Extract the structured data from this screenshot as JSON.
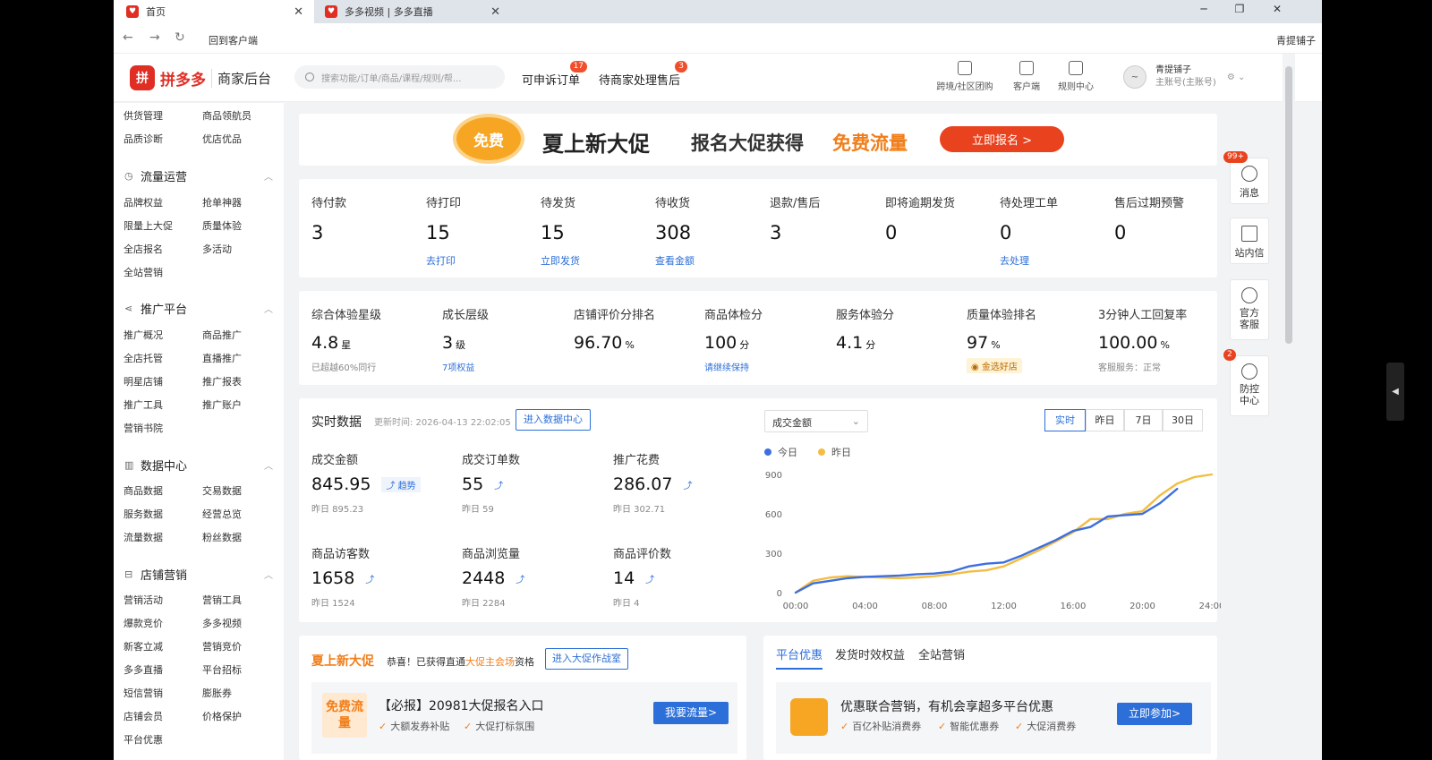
{
  "browser": {
    "tabs": [
      {
        "label": "首页",
        "active": true
      },
      {
        "label": "多多视频 | 多多直播",
        "active": false
      }
    ],
    "nav_link": "回到客户端",
    "nav_right": "青提铺子"
  },
  "header": {
    "brand": "拼多多",
    "sub": "商家后台",
    "search_placeholder": "搜索功能/订单/商品/课程/规则/帮...",
    "links": [
      {
        "label": "可申诉订单",
        "badge": "17"
      },
      {
        "label": "待商家处理售后",
        "badge": "3"
      }
    ],
    "icons": [
      {
        "label": "跨境/社区团购",
        "icon": "store-icon"
      },
      {
        "label": "客户端",
        "icon": "desktop-icon"
      },
      {
        "label": "规则中心",
        "icon": "document-icon"
      }
    ],
    "account": {
      "name": "青提铺子",
      "role": "主账号(主账号)"
    }
  },
  "sidebar": {
    "top_items": [
      "供货管理",
      "商品领航员",
      "品质诊断",
      "优店优品"
    ],
    "groups": [
      {
        "title": "流量运营",
        "icon": "clock-icon",
        "items": [
          "品牌权益",
          "抢单神器",
          "限量上大促",
          "质量体验",
          "全店报名",
          "多活动",
          "全站营销"
        ]
      },
      {
        "title": "推广平台",
        "icon": "share-icon",
        "items": [
          "推广概况",
          "商品推广",
          "全店托管",
          "直播推广",
          "明星店铺",
          "推广报表",
          "推广工具",
          "推广账户",
          "营销书院"
        ]
      },
      {
        "title": "数据中心",
        "icon": "bar-chart-icon",
        "items": [
          "商品数据",
          "交易数据",
          "服务数据",
          "经营总览",
          "流量数据",
          "粉丝数据"
        ]
      },
      {
        "title": "店铺营销",
        "icon": "shop-icon",
        "items": [
          "营销活动",
          "营销工具",
          "爆款竞价",
          "多多视频",
          "新客立减",
          "营销竞价",
          "多多直播",
          "平台招标",
          "短信营销",
          "膨胀券",
          "店铺会员",
          "价格保护",
          "平台优惠"
        ]
      }
    ]
  },
  "banner": {
    "badge": "免费",
    "title": "夏上新大促",
    "subtitle": "报名大促获得",
    "highlight": "免费流量",
    "cta": "立即报名 >"
  },
  "stats": [
    {
      "label": "待付款",
      "value": "3",
      "link": ""
    },
    {
      "label": "待打印",
      "value": "15",
      "link": "去打印"
    },
    {
      "label": "待发货",
      "value": "15",
      "link": "立即发货"
    },
    {
      "label": "待收货",
      "value": "308",
      "link": "查看金额"
    },
    {
      "label": "退款/售后",
      "value": "3",
      "link": ""
    },
    {
      "label": "即将逾期发货",
      "value": "0",
      "link": ""
    },
    {
      "label": "待处理工单",
      "value": "0",
      "link": "去处理"
    },
    {
      "label": "售后过期预警",
      "value": "0",
      "link": ""
    }
  ],
  "metrics": [
    {
      "label": "综合体验星级",
      "value": "4.8",
      "unit": "星",
      "footer": "已超越60%同行",
      "footer_link": false,
      "tag": ""
    },
    {
      "label": "成长层级",
      "value": "3",
      "unit": "级",
      "footer": "7项权益",
      "footer_link": true,
      "tag": ""
    },
    {
      "label": "店铺评价分排名",
      "value": "96.70",
      "unit": "%",
      "footer": "",
      "footer_link": false,
      "tag": ""
    },
    {
      "label": "商品体检分",
      "value": "100",
      "unit": "分",
      "footer": "请继续保持",
      "footer_link": true,
      "tag": ""
    },
    {
      "label": "服务体验分",
      "value": "4.1",
      "unit": "分",
      "footer": "",
      "footer_link": false,
      "tag": ""
    },
    {
      "label": "质量体验排名",
      "value": "97",
      "unit": "%",
      "footer": "",
      "footer_link": false,
      "tag": "金选好店"
    },
    {
      "label": "3分钟人工回复率",
      "value": "100.00",
      "unit": "%",
      "footer": "客服服务：正常",
      "footer_link": false,
      "tag": ""
    }
  ],
  "realtime": {
    "title": "实时数据",
    "updated": "更新时间: 2026-04-13 22:02:05",
    "data_center_btn": "进入数据中心",
    "stats": [
      {
        "label": "成交金额",
        "value": "845.95",
        "yesterday": "昨日 895.23",
        "trend": "趋势"
      },
      {
        "label": "成交订单数",
        "value": "55",
        "yesterday": "昨日 59",
        "trend": ""
      },
      {
        "label": "推广花费",
        "value": "286.07",
        "yesterday": "昨日 302.71",
        "trend": ""
      },
      {
        "label": "商品访客数",
        "value": "1658",
        "yesterday": "昨日 1524",
        "trend": ""
      },
      {
        "label": "商品浏览量",
        "value": "2448",
        "yesterday": "昨日 2284",
        "trend": ""
      },
      {
        "label": "商品评价数",
        "value": "14",
        "yesterday": "昨日 4",
        "trend": ""
      }
    ],
    "metric_select": "成交金额",
    "ranges": [
      "实时",
      "昨日",
      "7日",
      "30日"
    ],
    "active_range": "实时",
    "legend": [
      {
        "name": "今日",
        "color": "#3c6fe0"
      },
      {
        "name": "昨日",
        "color": "#f2bd42"
      }
    ]
  },
  "chart_data": {
    "type": "line",
    "x": [
      "00:00",
      "01:00",
      "02:00",
      "03:00",
      "04:00",
      "05:00",
      "06:00",
      "07:00",
      "08:00",
      "09:00",
      "10:00",
      "11:00",
      "12:00",
      "13:00",
      "14:00",
      "15:00",
      "16:00",
      "17:00",
      "18:00",
      "19:00",
      "20:00",
      "21:00",
      "22:00",
      "23:00",
      "24:00"
    ],
    "series": [
      {
        "name": "今日",
        "color": "#3c6fe0",
        "values": [
          0,
          70,
          90,
          110,
          120,
          125,
          130,
          140,
          145,
          160,
          200,
          220,
          230,
          280,
          340,
          400,
          470,
          500,
          580,
          590,
          600,
          680,
          790
        ]
      },
      {
        "name": "昨日",
        "color": "#f2bd42",
        "values": [
          0,
          90,
          115,
          125,
          120,
          115,
          110,
          115,
          125,
          140,
          160,
          170,
          200,
          260,
          320,
          390,
          460,
          560,
          560,
          600,
          620,
          740,
          830,
          880,
          900
        ]
      }
    ],
    "xticks": [
      "00:00",
      "04:00",
      "08:00",
      "12:00",
      "16:00",
      "20:00",
      "24:00"
    ],
    "yticks": [
      0,
      300,
      600,
      900
    ],
    "ylim": [
      0,
      900
    ],
    "grid": false,
    "legend": "top-left"
  },
  "promo": {
    "title": "夏上新大促",
    "status_pre": "恭喜！已获得直通",
    "status_hl": "大促主会场",
    "status_post": "资格",
    "button": "进入大促作战室",
    "box": "免费流量",
    "item_title": "【必报】20981大促报名入口",
    "checks": [
      "大额发券补贴",
      "大促打标氛围"
    ],
    "cta": "我要流量>"
  },
  "platform": {
    "tabs": [
      "平台优惠",
      "发货时效权益",
      "全站营销"
    ],
    "active": "平台优惠",
    "item_title": "优惠联合营销，有机会享超多平台优惠",
    "checks": [
      "百亿补贴消费券",
      "智能优惠券",
      "大促消费券"
    ],
    "cta": "立即参加>"
  },
  "float_panel": [
    {
      "label": "消息",
      "badge": "99+",
      "icon": "bell-icon"
    },
    {
      "label": "站内信",
      "badge": "",
      "icon": "mail-icon"
    },
    {
      "label": "官方客服",
      "badge": "",
      "icon": "service-icon"
    },
    {
      "label": "防控中心",
      "badge": "2",
      "icon": "shield-icon"
    }
  ]
}
